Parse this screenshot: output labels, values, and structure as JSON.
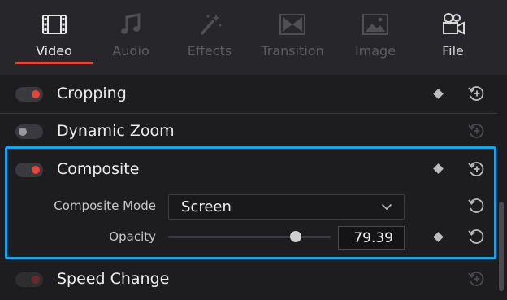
{
  "tabs": [
    {
      "label": "Video",
      "icon": "film-icon",
      "state": "active"
    },
    {
      "label": "Audio",
      "icon": "music-note-icon",
      "state": "disabled"
    },
    {
      "label": "Effects",
      "icon": "magic-wand-icon",
      "state": "disabled"
    },
    {
      "label": "Transition",
      "icon": "transition-icon",
      "state": "disabled"
    },
    {
      "label": "Image",
      "icon": "image-icon",
      "state": "disabled"
    },
    {
      "label": "File",
      "icon": "file-reel-icon",
      "state": "enabled"
    }
  ],
  "sections": {
    "cropping": {
      "title": "Cropping",
      "enabled": true
    },
    "dynamic_zoom": {
      "title": "Dynamic Zoom",
      "enabled": false
    },
    "composite": {
      "title": "Composite",
      "enabled": true,
      "mode_label": "Composite Mode",
      "mode_value": "Screen",
      "opacity_label": "Opacity",
      "opacity_value": "79.39",
      "opacity_slider_fraction": 0.79
    },
    "speed_change": {
      "title": "Speed Change",
      "enabled": true
    }
  },
  "colors": {
    "accent_red": "#e3443b",
    "highlight_blue": "#1aa3f0",
    "panel_bg": "#1d1d20",
    "tabbar_bg": "#27272b"
  }
}
